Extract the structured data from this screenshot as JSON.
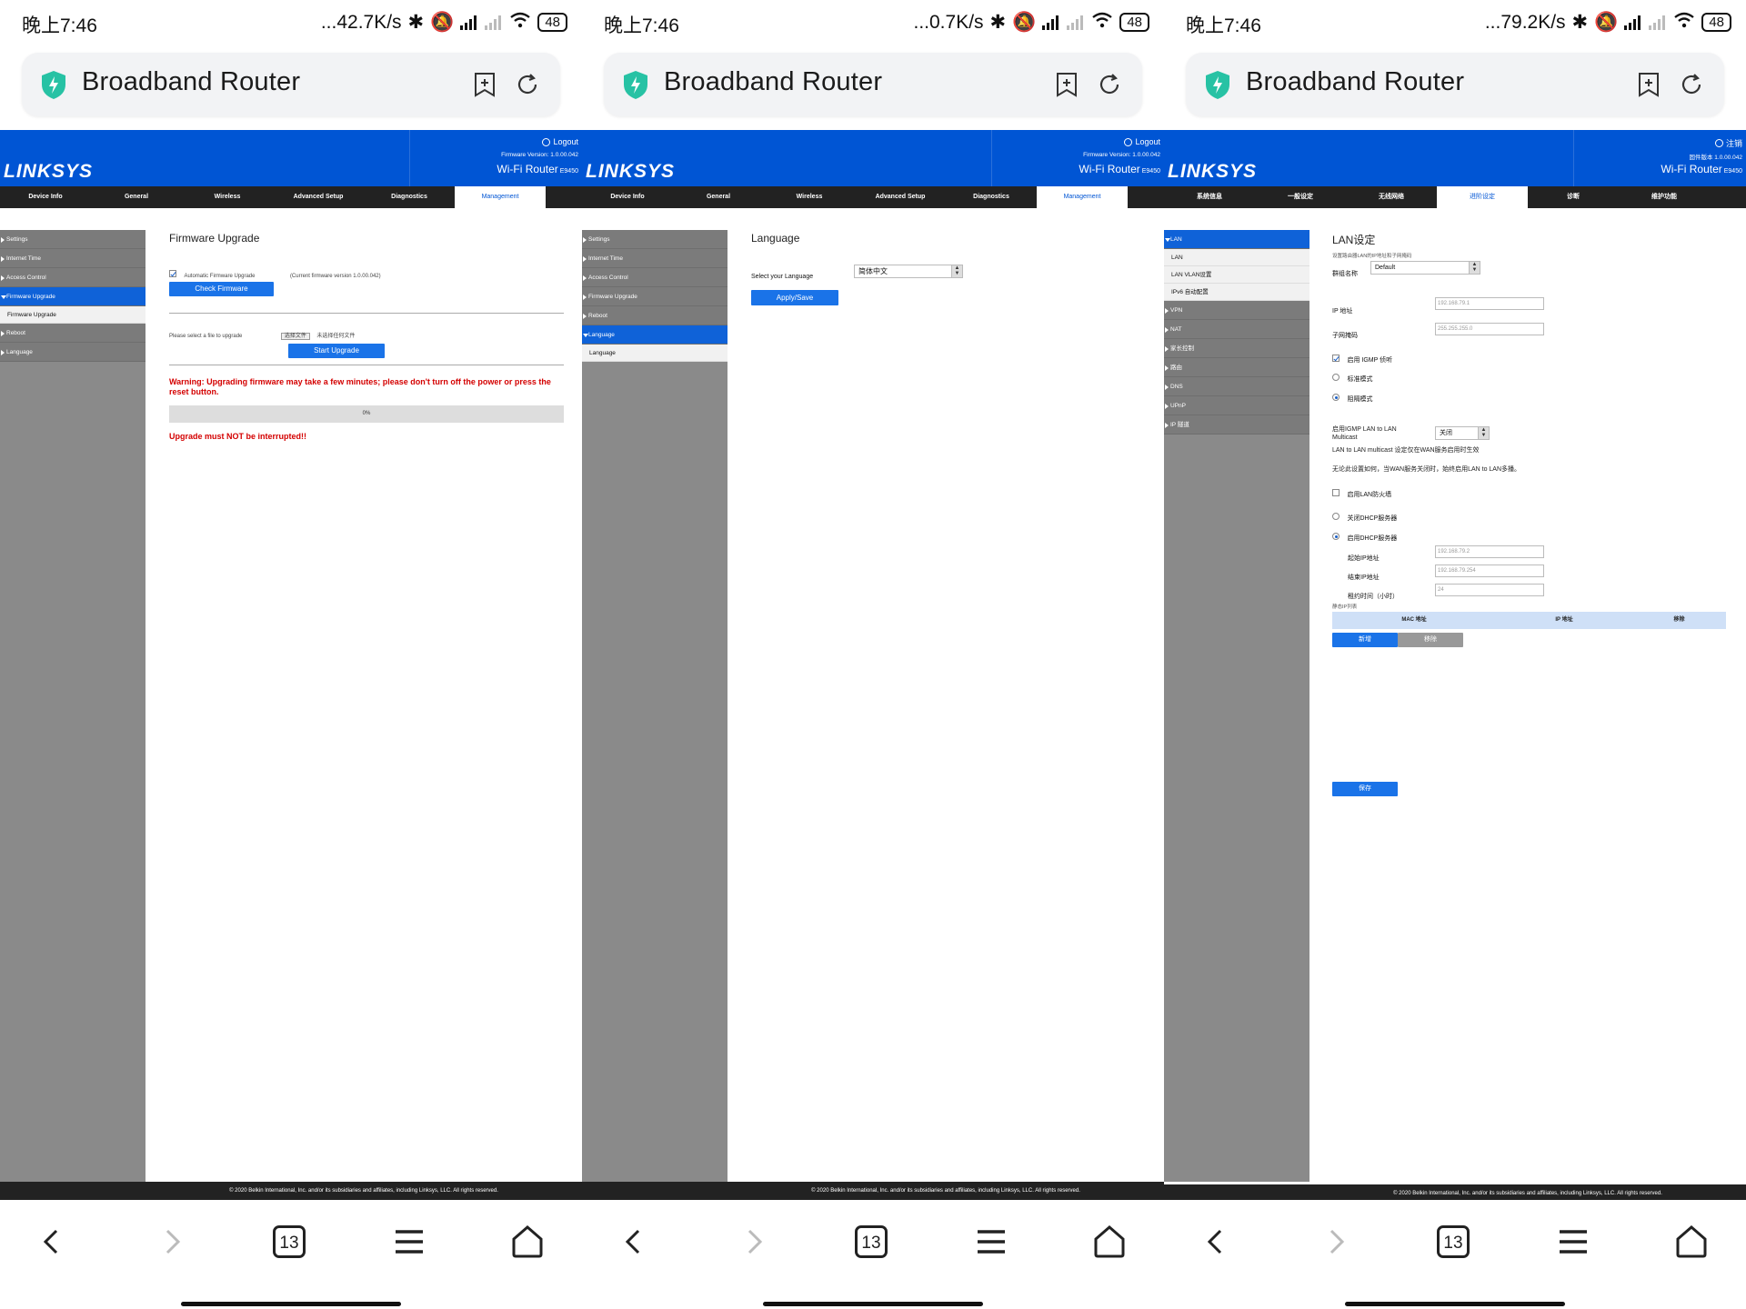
{
  "screens": [
    {
      "status": {
        "time": "晚上7:46",
        "speed": "...42.7K/s",
        "battery": "48"
      },
      "browser": {
        "title": "Broadband Router",
        "tabs_count": "13"
      },
      "router": {
        "logo": "LINKSYS",
        "logout": "Logout",
        "firmware": "Firmware Version: 1.0.00.042",
        "model": "Wi-Fi Router",
        "model_code": "E9450",
        "nav": [
          "Device Info",
          "General",
          "Wireless",
          "Advanced Setup",
          "Diagnostics",
          "Management"
        ],
        "sidebar": [
          "Settings",
          "Internet Time",
          "Access Control",
          "Firmware Upgrade",
          "Firmware Upgrade",
          "Reboot",
          "Language"
        ],
        "footer": "© 2020 Belkin International, Inc. and/or its subsidiaries and affiliates, including Linksys, LLC. All rights reserved."
      },
      "content": {
        "title": "Firmware Upgrade",
        "auto_label": "Automatic Firmware Upgrade",
        "current_version": "(Current firmware version 1.0.00.042)",
        "check_btn": "Check Firmware",
        "select_label": "Please select a file to upgrade",
        "choose_file": "选择文件",
        "no_file": "未选择任何文件",
        "start_btn": "Start Upgrade",
        "warning": "Warning: Upgrading firmware may take a few minutes; please don't turn off the power or press the reset button.",
        "progress": "0%",
        "must_not": "Upgrade must NOT be interrupted!!"
      }
    },
    {
      "status": {
        "time": "晚上7:46",
        "speed": "...0.7K/s",
        "battery": "48"
      },
      "browser": {
        "title": "Broadband Router",
        "tabs_count": "13"
      },
      "router": {
        "logo": "LINKSYS",
        "logout": "Logout",
        "firmware": "Firmware Version: 1.0.00.042",
        "model": "Wi-Fi Router",
        "model_code": "E9450",
        "nav": [
          "Device Info",
          "General",
          "Wireless",
          "Advanced Setup",
          "Diagnostics",
          "Management"
        ],
        "sidebar": [
          "Settings",
          "Internet Time",
          "Access Control",
          "Firmware Upgrade",
          "Reboot",
          "Language",
          "Language"
        ],
        "footer": "© 2020 Belkin International, Inc. and/or its subsidiaries and affiliates, including Linksys, LLC. All rights reserved."
      },
      "content": {
        "title": "Language",
        "select_label": "Select your Language",
        "selected": "简体中文",
        "apply_btn": "Apply/Save"
      }
    },
    {
      "status": {
        "time": "晚上7:46",
        "speed": "...79.2K/s",
        "battery": "48"
      },
      "browser": {
        "title": "Broadband Router",
        "tabs_count": "13"
      },
      "router": {
        "logo": "LINKSYS",
        "logout": "注销",
        "firmware": "固件版本 1.0.00.042",
        "model": "Wi-Fi Router",
        "model_code": "E9450",
        "nav": [
          "系统信息",
          "一般设定",
          "无线网络",
          "进阶设定",
          "诊断",
          "维护功能"
        ],
        "sidebar": [
          "LAN",
          "LAN",
          "LAN VLAN设置",
          "IPv6 自动配置",
          "VPN",
          "NAT",
          "家长控制",
          "路由",
          "DNS",
          "UPnP",
          "IP 隧道"
        ],
        "footer": "© 2020 Belkin International, Inc. and/or its subsidiaries and affiliates, including Linksys, LLC. All rights reserved."
      },
      "content": {
        "title": "LAN设定",
        "subtitle": "设置路由器LAN的IP地址和子网掩码",
        "group_label": "群组名称",
        "group_value": "Default",
        "ip_label": "IP 地址",
        "ip_value": "192.168.79.1",
        "mask_label": "子网掩码",
        "mask_value": "255.255.255.0",
        "igmp_label": "启用 IGMP 侦听",
        "standard_mode": "标准模式",
        "blocking_mode": "阻隔模式",
        "igmp_lan_label": "启用IGMP LAN to LAN Multicast",
        "igmp_lan_value": "关闭",
        "lan_note": "LAN to LAN multicast 设定仅在WAN服务启用时生效",
        "lan_note2": "无论此设置如何，当WAN服务关闭时，始终启用LAN to LAN多播。",
        "firewall_label": "启用LAN防火墙",
        "dhcp_off": "关闭DHCP服务器",
        "dhcp_on": "启用DHCP服务器",
        "start_ip_label": "起始IP地址",
        "start_ip": "192.168.79.2",
        "end_ip_label": "结束IP地址",
        "end_ip": "192.168.79.254",
        "lease_label": "租约时间（小时）",
        "lease": "24",
        "static_ip_label": "静态IP列表",
        "table_headers": [
          "MAC 地址",
          "IP 地址",
          "移除"
        ],
        "add_btn": "新增",
        "remove_btn": "移除",
        "save_btn": "保存"
      }
    }
  ],
  "colors": {
    "router_blue": "#0055d4",
    "button_blue": "#1a73e8",
    "warning_red": "#d40000",
    "shield_green": "#27c2a4"
  }
}
